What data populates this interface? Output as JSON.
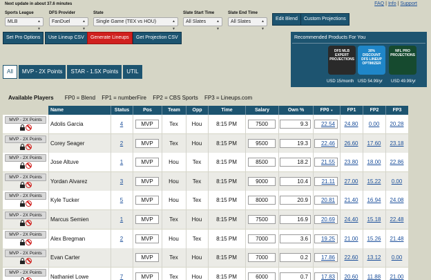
{
  "header": {
    "update_note": "Next update in about 37.6 minutes",
    "links": [
      "FAQ",
      "Info",
      "Support"
    ]
  },
  "filters": {
    "sports_league": {
      "label": "Sports League",
      "value": "MLB"
    },
    "dfs_provider": {
      "label": "DFS Provider",
      "value": "FanDuel"
    },
    "state": {
      "label": "State",
      "value": "Single Game (TEX vs HOU)"
    },
    "slate_start": {
      "label": "Slate Start Time",
      "value": "All Slates"
    },
    "slate_end": {
      "label": "Slate End Time",
      "value": "All Slates"
    }
  },
  "buttons": {
    "edit_blend": "Edit Blend",
    "custom_projections": "Custom Projections",
    "set_pro_options": "Set Pro Options",
    "use_lineup_csv": "Use Lineup CSV",
    "generate_lineups": "Generate Lineups",
    "get_projection_csv": "Get Projection CSV"
  },
  "promo": {
    "title": "Recommended Products For You",
    "products": [
      {
        "name": "DFS MLB EXPERT PROJECTIONS",
        "price": "USD 15/month",
        "color": "#2a2a2a"
      },
      {
        "name": "30% DISCOUNT DFS LINEUP OPTIMIZER",
        "price": "USD 54.99/yr",
        "color": "#1f86c8"
      },
      {
        "name": "NFL PRO PROJECTIONS",
        "price": "USD 49.99/yr",
        "color": "#164a2f"
      }
    ]
  },
  "tabs": [
    "All",
    "MVP - 2X Points",
    "STAR - 1.5X Points",
    "UTIL"
  ],
  "legend": {
    "title": "Available Players",
    "items": [
      "FP0 = Blend",
      "FP1 = numberFire",
      "FP2 = CBS Sports",
      "FP3 = Lineups.com"
    ]
  },
  "table": {
    "columns": [
      "Name",
      "Status",
      "Pos",
      "Team",
      "Opp",
      "Time",
      "Salary",
      "Own %",
      "FP0",
      "FP1",
      "FP2",
      "FP3"
    ],
    "mvp_label": "MVP - 2X Points",
    "rows": [
      {
        "name": "Adolis Garcia",
        "status": "4",
        "pos": "MVP",
        "team": "Tex",
        "opp": "Hou",
        "time": "8:15 PM",
        "salary": "7500",
        "own": "9.3",
        "fp0": "22.54",
        "fp1": "24.80",
        "fp2": "0.00",
        "fp3": "20.28"
      },
      {
        "name": "Corey Seager",
        "status": "2",
        "pos": "MVP",
        "team": "Tex",
        "opp": "Hou",
        "time": "8:15 PM",
        "salary": "9500",
        "own": "19.3",
        "fp0": "22.46",
        "fp1": "26.60",
        "fp2": "17.60",
        "fp3": "23.18"
      },
      {
        "name": "Jose Altuve",
        "status": "1",
        "pos": "MVP",
        "team": "Hou",
        "opp": "Tex",
        "time": "8:15 PM",
        "salary": "8500",
        "own": "18.2",
        "fp0": "21.55",
        "fp1": "23.80",
        "fp2": "18.00",
        "fp3": "22.86"
      },
      {
        "name": "Yordan Alvarez",
        "status": "3",
        "pos": "MVP",
        "team": "Hou",
        "opp": "Tex",
        "time": "8:15 PM",
        "salary": "9000",
        "own": "10.4",
        "fp0": "21.11",
        "fp1": "27.00",
        "fp2": "15.22",
        "fp3": "0.00"
      },
      {
        "name": "Kyle Tucker",
        "status": "5",
        "pos": "MVP",
        "team": "Hou",
        "opp": "Tex",
        "time": "8:15 PM",
        "salary": "8000",
        "own": "20.9",
        "fp0": "20.81",
        "fp1": "21.40",
        "fp2": "16.94",
        "fp3": "24.08"
      },
      {
        "name": "Marcus Semien",
        "status": "1",
        "pos": "MVP",
        "team": "Tex",
        "opp": "Hou",
        "time": "8:15 PM",
        "salary": "7500",
        "own": "16.9",
        "fp0": "20.69",
        "fp1": "24.40",
        "fp2": "15.18",
        "fp3": "22.48"
      },
      {
        "name": "Alex Bregman",
        "status": "2",
        "pos": "MVP",
        "team": "Hou",
        "opp": "Tex",
        "time": "8:15 PM",
        "salary": "7000",
        "own": "3.6",
        "fp0": "19.25",
        "fp1": "21.00",
        "fp2": "15.26",
        "fp3": "21.48"
      },
      {
        "name": "Evan Carter",
        "status": "",
        "pos": "MVP",
        "team": "Tex",
        "opp": "Hou",
        "time": "8:15 PM",
        "salary": "7000",
        "own": "0.2",
        "fp0": "17.86",
        "fp1": "22.60",
        "fp2": "13.12",
        "fp3": "0.00"
      },
      {
        "name": "Nathaniel Lowe",
        "status": "7",
        "pos": "MVP",
        "team": "Tex",
        "opp": "Hou",
        "time": "8:15 PM",
        "salary": "6000",
        "own": "0.7",
        "fp0": "17.83",
        "fp1": "20.60",
        "fp2": "11.88",
        "fp3": "21.00"
      }
    ]
  }
}
